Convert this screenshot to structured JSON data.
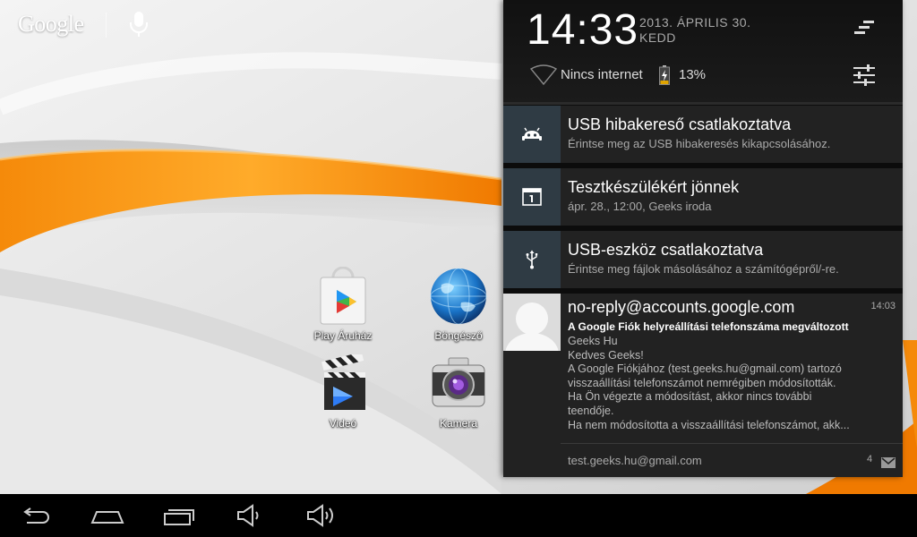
{
  "search": {
    "logo": "Google"
  },
  "apps": [
    {
      "label": "Play Áruház",
      "icon": "play-store-icon"
    },
    {
      "label": "Böngésző",
      "icon": "browser-globe-icon"
    },
    {
      "label": "Videó",
      "icon": "video-clapper-icon"
    },
    {
      "label": "Kamera",
      "icon": "camera-icon"
    }
  ],
  "status": {
    "time": "14:33",
    "date": "2013. ÁPRILIS 30.",
    "weekday": "KEDD",
    "network": "Nincs internet",
    "battery": "13%"
  },
  "notifications": [
    {
      "title": "USB hibakereső csatlakoztatva",
      "subtitle": "Érintse meg az USB hibakeresés kikapcsolásához.",
      "icon": "android-debug-icon"
    },
    {
      "title": "Tesztkészülékért jönnek",
      "subtitle": "ápr. 28., 12:00, Geeks iroda",
      "icon": "calendar-icon"
    },
    {
      "title": "USB-eszköz csatlakoztatva",
      "subtitle": "Érintse meg fájlok másolásához a számítógépről/-re.",
      "icon": "usb-icon"
    }
  ],
  "email": {
    "from": "no-reply@accounts.google.com",
    "time": "14:03",
    "subject": "A Google Fiók helyreállítási telefonszáma megváltozott",
    "lines": [
      "Geeks Hu",
      "Kedves Geeks!",
      "A Google Fiókjához (test.geeks.hu@gmail.com) tartozó",
      "visszaállítási telefonszámot nemrégiben módosították.",
      "Ha Ön végezte a módosítást, akkor nincs további",
      "teendője.",
      "Ha nem módosította a visszaállítási telefonszámot, akk..."
    ],
    "account": "test.geeks.hu@gmail.com",
    "count": "4"
  },
  "colors": {
    "accent_orange": "#f7941d",
    "shade_bg": "#0c0c0c",
    "notif_bg": "#222222",
    "icon_tile": "#2f3b44"
  }
}
